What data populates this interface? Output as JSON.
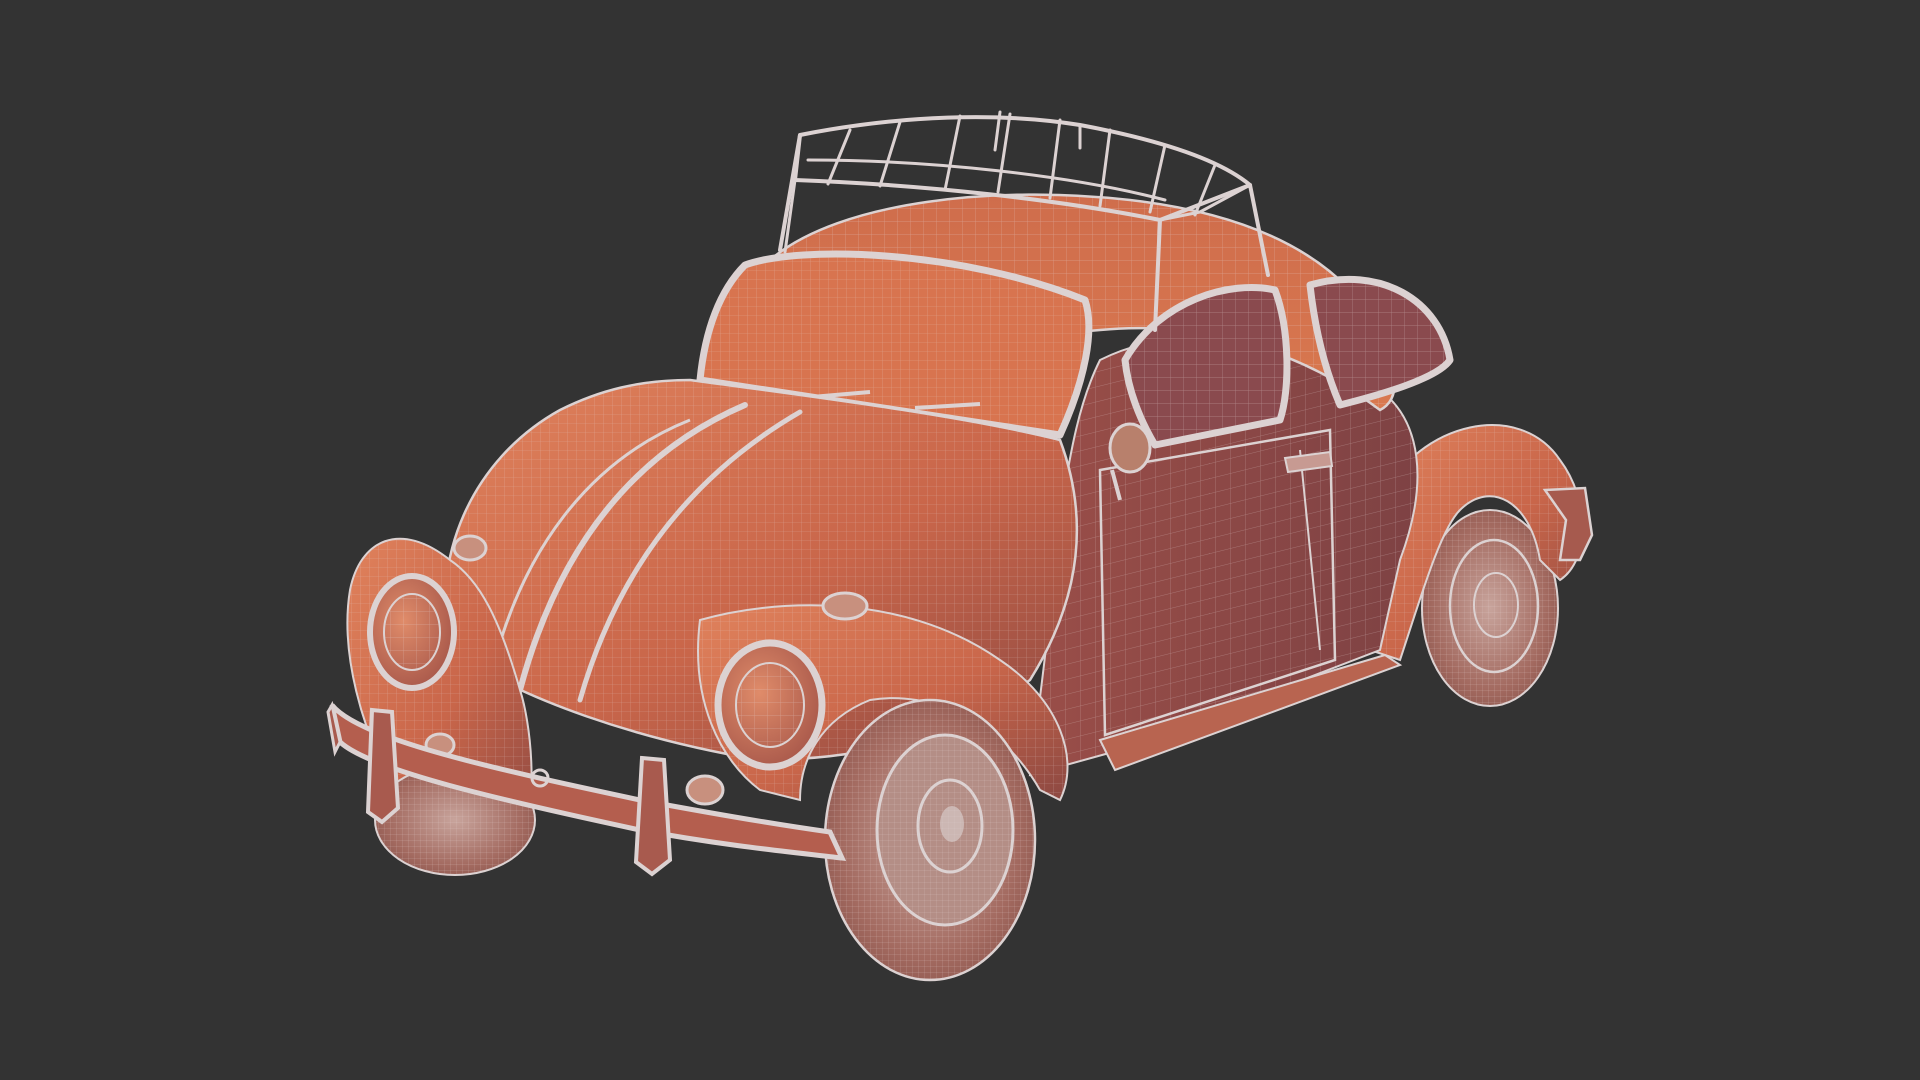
{
  "scene": {
    "background_color": "#333333",
    "wire_color": "#dcd2d2",
    "body_color": "#d4714e",
    "body_shadow_color": "#7a3a36",
    "side_color": "#8e4a48",
    "glass_color": "#d8744f",
    "tire_color": "#9a5a52",
    "hub_color": "#caa7a0"
  }
}
